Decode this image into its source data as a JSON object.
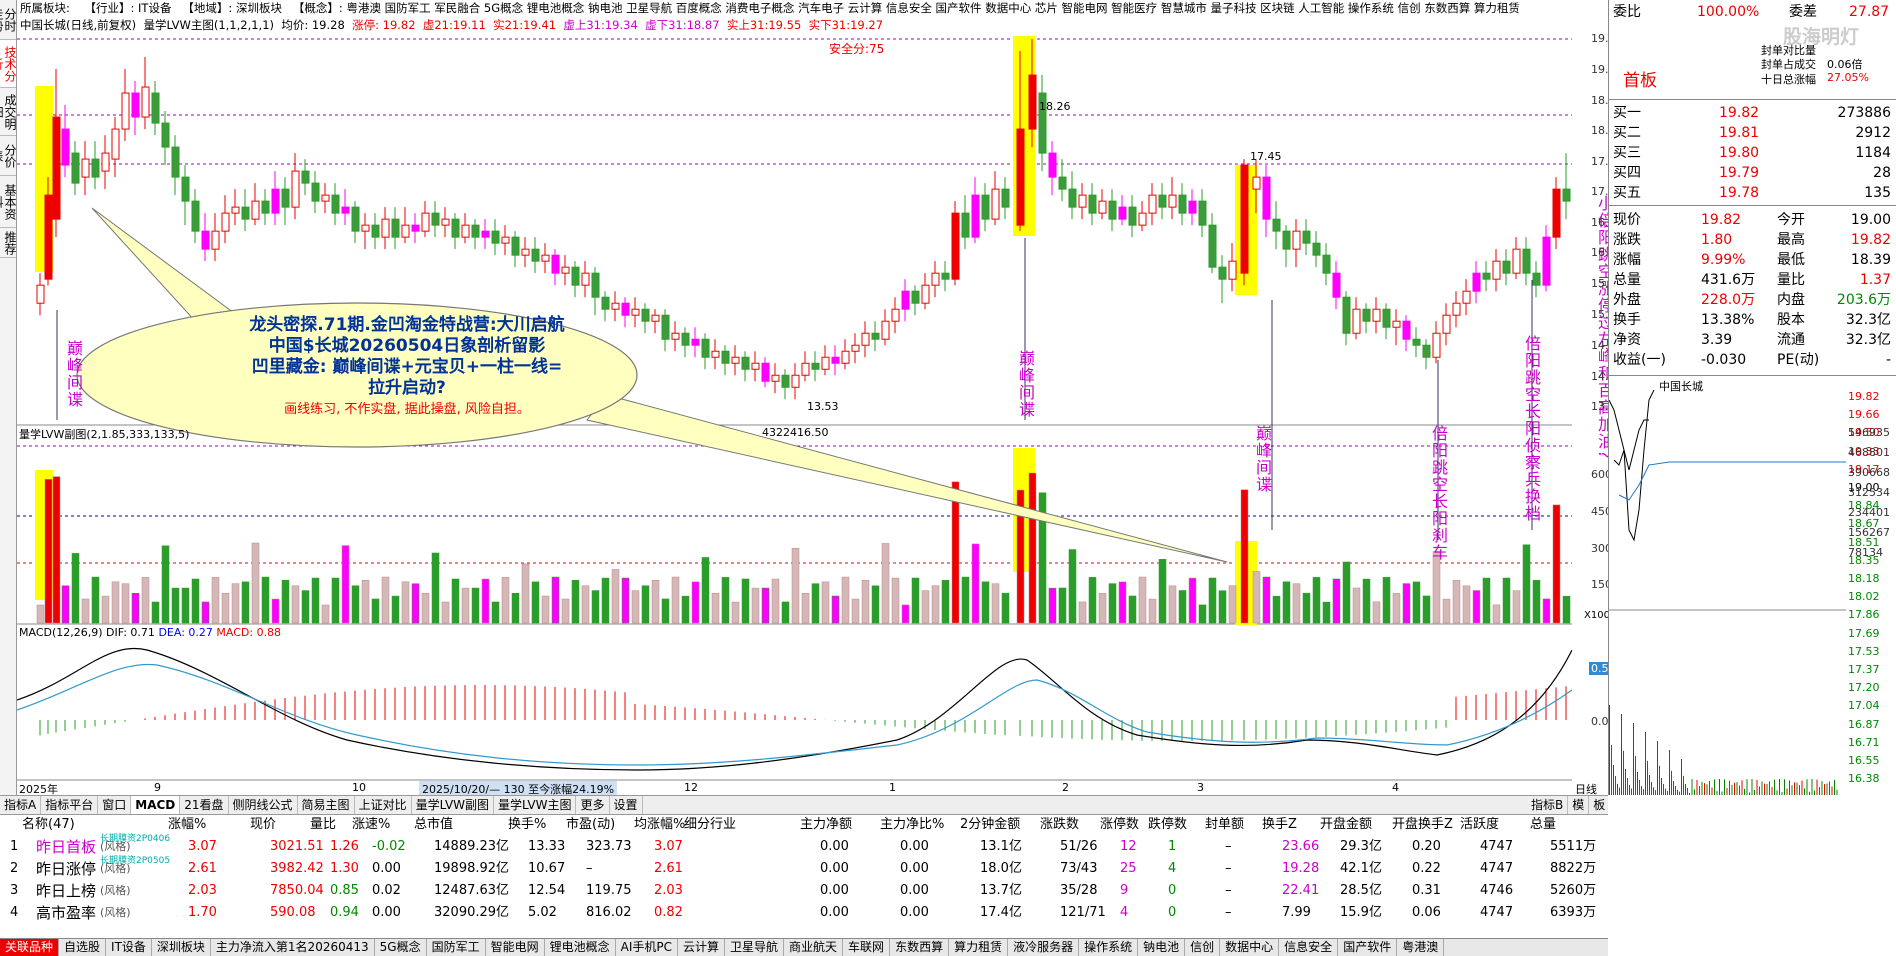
{
  "left_tabs": [
    "分时走势",
    "技术分析",
    "成交明细",
    "分价表",
    "基本资料",
    "推荐"
  ],
  "info_bar": {
    "label1": "所属板块:",
    "industry": "【行业】: IT设备",
    "region": "【地域】: 深圳板块",
    "concept_label": "【概念】:",
    "concepts": "粤港澳 国防军工 军民融合 5G概念 锂电池概念 钠电池 卫星导航 百度概念 消费电子概念 汽车电子 云计算 信息安全 国产软件 数据中心 芯片 智能电网 智能医疗 智慧城市 量子科技 区块链 人工智能 操作系统 信创 东数西算 算力租赁"
  },
  "title_bar": {
    "stock": "中国长城(日线,前复权)",
    "indicator": "量学LVW主图(1,1,2,1,1)",
    "avg": "均价: 19.28",
    "limitup": "涨停: 19.82",
    "v21": "虚21:19.11",
    "s21": "实21:19.41",
    "vs31": "虚上31:19.34",
    "vx31": "虚下31:18.87",
    "ss31": "实上31:19.55",
    "sx31": "实下31:19.27"
  },
  "annotations": {
    "safe": "安全分:75",
    "high1": "18.26",
    "high2": "17.45",
    "low": "13.53",
    "vol_title": "量学LVW副图(2,1.85,333,133,5)",
    "vol_extra": "4322416.50",
    "macd_title": "MACD(12,26,9)",
    "dif": "DIF: 0.71",
    "dea": "DEA: 0.27",
    "macd": "MACD: 0.88",
    "macd_val": "0.52",
    "x100": "X100"
  },
  "bubble": {
    "l1": "龙头密探.71期.金凹淘金特战营:大川启航",
    "l2": "中国$长城20260504日象剖析留影",
    "l3": "凹里藏金: 巅峰间谍+元宝贝+一柱一线=",
    "l4": "拉升启动?",
    "l5": "画线练习, 不作实盘, 据此操盘, 风险自担。"
  },
  "vertical_notes": {
    "a": "巅峰间谍",
    "b": "巅峰间谍",
    "c": "巅峰间谍",
    "d": "倍阳跳空长阳刹车",
    "e": "倍阳跳空长阳侦察兵换档",
    "f": "小倍阳跳空涨停过左峰和百高加油?"
  },
  "price_ticks": [
    "19.50",
    "19.00",
    "18.50",
    "18.00",
    "17.50",
    "17.00",
    "16.50",
    "16.00",
    "15.50",
    "15.00",
    "14.50",
    "14.00",
    "13.50"
  ],
  "vol_ticks": [
    "60000",
    "45000",
    "30000",
    "15000"
  ],
  "macd_ticks": [
    "0.00"
  ],
  "date_axis": {
    "y2025": "2025年",
    "m9": "9",
    "m10": "10",
    "m12": "12",
    "m1": "1",
    "m2": "2",
    "m3": "3",
    "m4": "4",
    "range": "2025/10/20/— 130 至今涨幅24.19%",
    "daily": "日线"
  },
  "bottom_tabs": [
    "指标A",
    "指标平台",
    "窗口",
    "MACD",
    "21看盘",
    "侧阴线公式",
    "简易主图",
    "上证对比",
    "量学LVW副图",
    "量学LVW主图",
    "更多",
    "设置"
  ],
  "bottom_right_tabs": [
    "指标B",
    "模",
    "板"
  ],
  "right_panel": {
    "wb_label": "委比",
    "wb": "100.00%",
    "wc_label": "委差",
    "wc": "27.87",
    "title": "首板",
    "fengdan1": "封单对比量",
    "fengdan2": "封单占成交",
    "fengdan2v": "0.06倍",
    "shiri": "十日总涨幅",
    "shiriv": "27.05%",
    "buy": [
      {
        "l": "买一",
        "p": "19.82",
        "v": "273886"
      },
      {
        "l": "买二",
        "p": "19.81",
        "v": "2912"
      },
      {
        "l": "买三",
        "p": "19.80",
        "v": "1184"
      },
      {
        "l": "买四",
        "p": "19.79",
        "v": "28"
      },
      {
        "l": "买五",
        "p": "19.78",
        "v": "135"
      }
    ],
    "stats": [
      [
        "现价",
        "19.82",
        "今开",
        "19.00"
      ],
      [
        "涨跌",
        "1.80",
        "最高",
        "19.82"
      ],
      [
        "涨幅",
        "9.99%",
        "最低",
        "18.39"
      ],
      [
        "总量",
        "431.6万",
        "量比",
        "1.37"
      ],
      [
        "外盘",
        "228.0万",
        "内盘",
        "203.6万"
      ],
      [
        "换手",
        "13.38%",
        "股本",
        "32.3亿"
      ],
      [
        "净资",
        "3.39",
        "流通",
        "32.3亿"
      ],
      [
        "收益(一)",
        "-0.030",
        "PE(动)",
        "-"
      ]
    ],
    "mini_title": "中国长城",
    "mini_ticks": [
      "19.82",
      "19.66",
      "19.50",
      "19.33",
      "19.17",
      "19.00",
      "18.84",
      "18.67",
      "18.51",
      "18.35",
      "18.18",
      "18.02",
      "17.86",
      "17.69",
      "17.53",
      "17.37",
      "17.20",
      "17.04",
      "16.87",
      "16.71",
      "16.55",
      "16.38"
    ],
    "vol_mini_ticks": [
      "546935",
      "468801",
      "390668",
      "312534",
      "234401",
      "156267",
      "78134"
    ]
  },
  "table": {
    "headers": [
      "名称(47)",
      "涨幅%",
      "现价",
      "量比",
      "涨速%",
      "总市值",
      "换手%",
      "市盈(动)",
      "均涨幅%",
      "细分行业",
      "主力净额",
      "主力净比%",
      "2分钟金额",
      "涨跌数",
      "涨停数",
      "跌停数",
      "封单额",
      "换手Z",
      "开盘金额",
      "开盘换手Z",
      "活跃度",
      "总量"
    ],
    "rows": [
      {
        "n": "1",
        "name": "昨日首板",
        "sub": "(风格)",
        "tag": "长期膜资2P0406",
        "c": [
          "3.07",
          "3021.51",
          "1.26",
          "-0.02",
          "14889.23亿",
          "13.33",
          "323.73",
          "3.07",
          "",
          "0.00",
          "0.00",
          "13.1亿",
          "51/26",
          "12",
          "1",
          "–",
          "23.66",
          "29.3亿",
          "0.20",
          "4747",
          "5511万"
        ]
      },
      {
        "n": "2",
        "name": "昨日涨停",
        "sub": "(风格)",
        "tag": "长期膜资2P0505",
        "c": [
          "2.61",
          "3982.42",
          "1.30",
          "0.00",
          "19898.92亿",
          "10.67",
          "–",
          "2.61",
          "",
          "0.00",
          "0.00",
          "18.0亿",
          "73/43",
          "25",
          "4",
          "–",
          "19.28",
          "42.1亿",
          "0.22",
          "4747",
          "8822万"
        ]
      },
      {
        "n": "3",
        "name": "昨日上榜",
        "sub": "(风格)",
        "tag": "",
        "c": [
          "2.03",
          "7850.04",
          "0.85",
          "0.02",
          "12487.63亿",
          "12.54",
          "119.75",
          "2.03",
          "",
          "0.00",
          "0.00",
          "13.7亿",
          "35/28",
          "9",
          "0",
          "–",
          "22.41",
          "28.5亿",
          "0.31",
          "4746",
          "5260万"
        ]
      },
      {
        "n": "4",
        "name": "高市盈率",
        "sub": "(风格)",
        "tag": "",
        "c": [
          "1.70",
          "590.08",
          "0.94",
          "0.00",
          "32090.29亿",
          "5.02",
          "816.02",
          "0.82",
          "",
          "0.00",
          "0.00",
          "17.4亿",
          "121/71",
          "4",
          "0",
          "–",
          "7.99",
          "15.9亿",
          "0.06",
          "4747",
          "6393万"
        ]
      }
    ]
  },
  "sector_tabs": [
    "关联品种",
    "自选股",
    "IT设备",
    "深圳板块",
    "主力净流入第1名20260413",
    "5G概念",
    "国防军工",
    "智能电网",
    "锂电池概念",
    "AI手机PC",
    "云计算",
    "卫星导航",
    "商业航天",
    "车联网",
    "东数西算",
    "算力租赁",
    "液冷服务器",
    "操作系统",
    "钠电池",
    "信创",
    "数据中心",
    "信息安全",
    "国产软件",
    "粤港澳"
  ],
  "watermark": "股海明灯"
}
